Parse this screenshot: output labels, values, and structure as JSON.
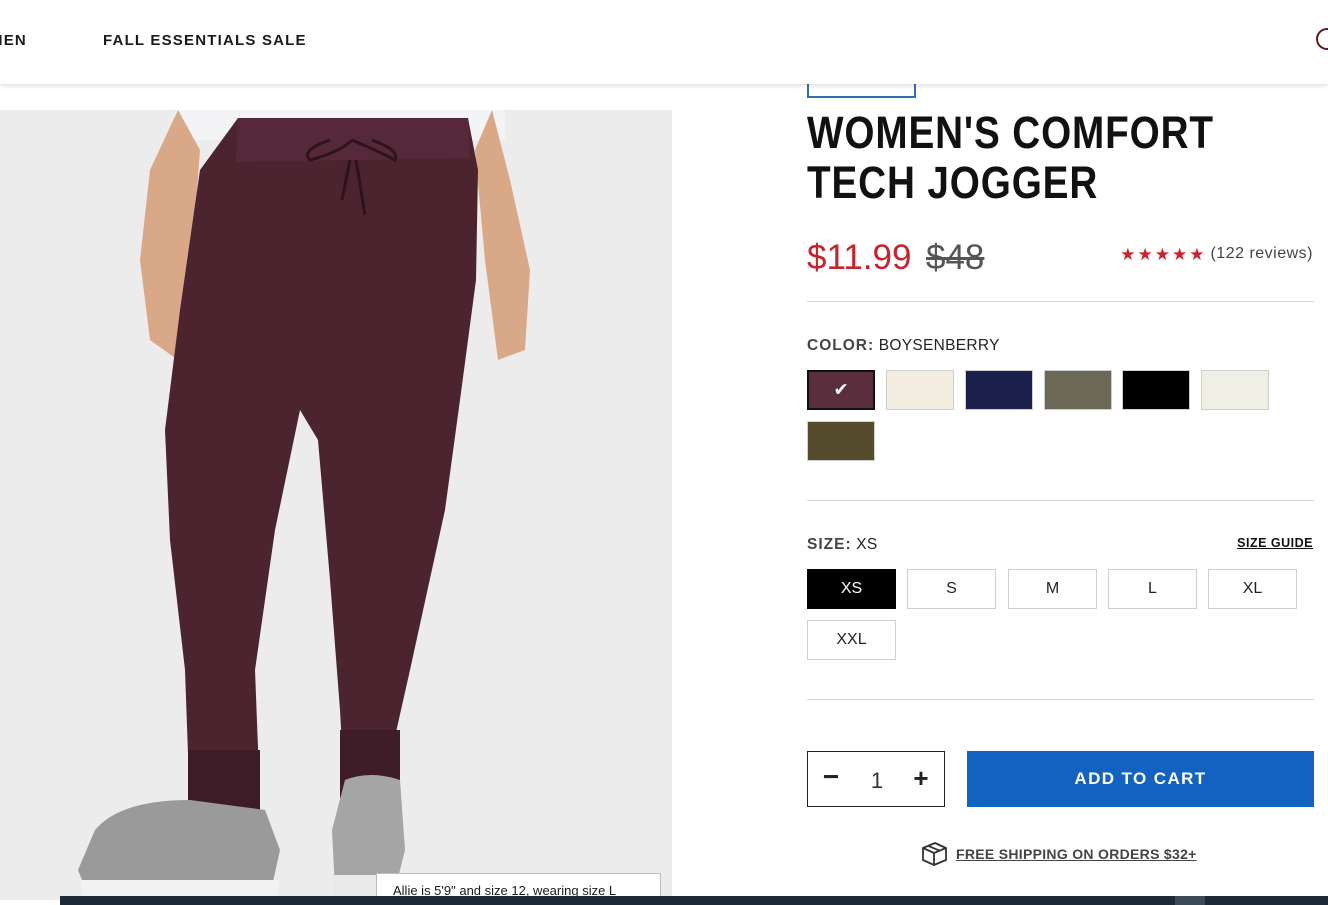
{
  "header": {
    "nav": [
      {
        "label": "MEN"
      },
      {
        "label": "FALL ESSENTIALS SALE"
      }
    ]
  },
  "product": {
    "title": "WOMEN'S COMFORT TECH JOGGER",
    "price_sale": "$11.99",
    "price_original": "$48",
    "rating": {
      "stars": 5,
      "star_glyph": "★",
      "reviews_label": "(122 reviews)"
    },
    "image_caption": "Allie is 5'9\" and size 12, wearing size L",
    "image_colors": {
      "pants": "#4b2430",
      "background": "#ececed"
    }
  },
  "color": {
    "label": "COLOR:",
    "selected_name": "BOYSENBERRY",
    "check_glyph": "✔",
    "swatches": [
      {
        "name": "boysenberry",
        "hex": "#5a2e3c",
        "selected": true
      },
      {
        "name": "cream",
        "hex": "#f2ece1",
        "selected": false
      },
      {
        "name": "navy",
        "hex": "#1b1f4b",
        "selected": false
      },
      {
        "name": "olive-gray",
        "hex": "#6b6855",
        "selected": false
      },
      {
        "name": "black",
        "hex": "#000000",
        "selected": false
      },
      {
        "name": "off-white",
        "hex": "#f0efe6",
        "selected": false
      },
      {
        "name": "dark-olive",
        "hex": "#554c2e",
        "selected": false
      }
    ]
  },
  "size": {
    "label": "SIZE:",
    "selected": "XS",
    "guide_label": "SIZE GUIDE",
    "options": [
      "XS",
      "S",
      "M",
      "L",
      "XL",
      "XXL"
    ]
  },
  "cart": {
    "quantity": "1",
    "minus_glyph": "−",
    "plus_glyph": "+",
    "add_label": "ADD TO CART"
  },
  "shipping": {
    "label": "FREE SHIPPING ON ORDERS $32+"
  },
  "colors": {
    "sale_red": "#c8222b",
    "cta_blue": "#1262c2"
  }
}
